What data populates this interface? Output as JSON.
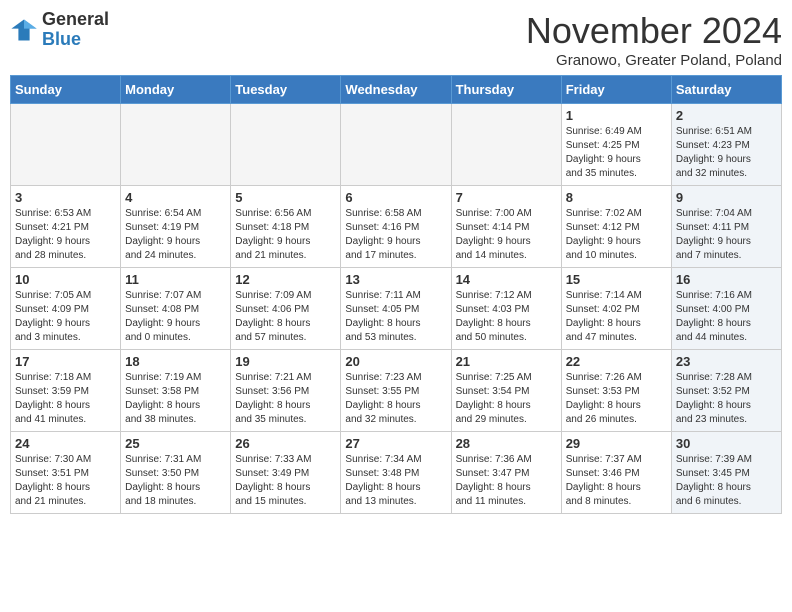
{
  "logo": {
    "general": "General",
    "blue": "Blue"
  },
  "title": "November 2024",
  "location": "Granowo, Greater Poland, Poland",
  "days_of_week": [
    "Sunday",
    "Monday",
    "Tuesday",
    "Wednesday",
    "Thursday",
    "Friday",
    "Saturday"
  ],
  "weeks": [
    [
      {
        "day": "",
        "info": "",
        "empty": true
      },
      {
        "day": "",
        "info": "",
        "empty": true
      },
      {
        "day": "",
        "info": "",
        "empty": true
      },
      {
        "day": "",
        "info": "",
        "empty": true
      },
      {
        "day": "",
        "info": "",
        "empty": true
      },
      {
        "day": "1",
        "info": "Sunrise: 6:49 AM\nSunset: 4:25 PM\nDaylight: 9 hours\nand 35 minutes.",
        "empty": false,
        "shaded": false
      },
      {
        "day": "2",
        "info": "Sunrise: 6:51 AM\nSunset: 4:23 PM\nDaylight: 9 hours\nand 32 minutes.",
        "empty": false,
        "shaded": true
      }
    ],
    [
      {
        "day": "3",
        "info": "Sunrise: 6:53 AM\nSunset: 4:21 PM\nDaylight: 9 hours\nand 28 minutes.",
        "empty": false,
        "shaded": false
      },
      {
        "day": "4",
        "info": "Sunrise: 6:54 AM\nSunset: 4:19 PM\nDaylight: 9 hours\nand 24 minutes.",
        "empty": false,
        "shaded": false
      },
      {
        "day": "5",
        "info": "Sunrise: 6:56 AM\nSunset: 4:18 PM\nDaylight: 9 hours\nand 21 minutes.",
        "empty": false,
        "shaded": false
      },
      {
        "day": "6",
        "info": "Sunrise: 6:58 AM\nSunset: 4:16 PM\nDaylight: 9 hours\nand 17 minutes.",
        "empty": false,
        "shaded": false
      },
      {
        "day": "7",
        "info": "Sunrise: 7:00 AM\nSunset: 4:14 PM\nDaylight: 9 hours\nand 14 minutes.",
        "empty": false,
        "shaded": false
      },
      {
        "day": "8",
        "info": "Sunrise: 7:02 AM\nSunset: 4:12 PM\nDaylight: 9 hours\nand 10 minutes.",
        "empty": false,
        "shaded": false
      },
      {
        "day": "9",
        "info": "Sunrise: 7:04 AM\nSunset: 4:11 PM\nDaylight: 9 hours\nand 7 minutes.",
        "empty": false,
        "shaded": true
      }
    ],
    [
      {
        "day": "10",
        "info": "Sunrise: 7:05 AM\nSunset: 4:09 PM\nDaylight: 9 hours\nand 3 minutes.",
        "empty": false,
        "shaded": false
      },
      {
        "day": "11",
        "info": "Sunrise: 7:07 AM\nSunset: 4:08 PM\nDaylight: 9 hours\nand 0 minutes.",
        "empty": false,
        "shaded": false
      },
      {
        "day": "12",
        "info": "Sunrise: 7:09 AM\nSunset: 4:06 PM\nDaylight: 8 hours\nand 57 minutes.",
        "empty": false,
        "shaded": false
      },
      {
        "day": "13",
        "info": "Sunrise: 7:11 AM\nSunset: 4:05 PM\nDaylight: 8 hours\nand 53 minutes.",
        "empty": false,
        "shaded": false
      },
      {
        "day": "14",
        "info": "Sunrise: 7:12 AM\nSunset: 4:03 PM\nDaylight: 8 hours\nand 50 minutes.",
        "empty": false,
        "shaded": false
      },
      {
        "day": "15",
        "info": "Sunrise: 7:14 AM\nSunset: 4:02 PM\nDaylight: 8 hours\nand 47 minutes.",
        "empty": false,
        "shaded": false
      },
      {
        "day": "16",
        "info": "Sunrise: 7:16 AM\nSunset: 4:00 PM\nDaylight: 8 hours\nand 44 minutes.",
        "empty": false,
        "shaded": true
      }
    ],
    [
      {
        "day": "17",
        "info": "Sunrise: 7:18 AM\nSunset: 3:59 PM\nDaylight: 8 hours\nand 41 minutes.",
        "empty": false,
        "shaded": false
      },
      {
        "day": "18",
        "info": "Sunrise: 7:19 AM\nSunset: 3:58 PM\nDaylight: 8 hours\nand 38 minutes.",
        "empty": false,
        "shaded": false
      },
      {
        "day": "19",
        "info": "Sunrise: 7:21 AM\nSunset: 3:56 PM\nDaylight: 8 hours\nand 35 minutes.",
        "empty": false,
        "shaded": false
      },
      {
        "day": "20",
        "info": "Sunrise: 7:23 AM\nSunset: 3:55 PM\nDaylight: 8 hours\nand 32 minutes.",
        "empty": false,
        "shaded": false
      },
      {
        "day": "21",
        "info": "Sunrise: 7:25 AM\nSunset: 3:54 PM\nDaylight: 8 hours\nand 29 minutes.",
        "empty": false,
        "shaded": false
      },
      {
        "day": "22",
        "info": "Sunrise: 7:26 AM\nSunset: 3:53 PM\nDaylight: 8 hours\nand 26 minutes.",
        "empty": false,
        "shaded": false
      },
      {
        "day": "23",
        "info": "Sunrise: 7:28 AM\nSunset: 3:52 PM\nDaylight: 8 hours\nand 23 minutes.",
        "empty": false,
        "shaded": true
      }
    ],
    [
      {
        "day": "24",
        "info": "Sunrise: 7:30 AM\nSunset: 3:51 PM\nDaylight: 8 hours\nand 21 minutes.",
        "empty": false,
        "shaded": false
      },
      {
        "day": "25",
        "info": "Sunrise: 7:31 AM\nSunset: 3:50 PM\nDaylight: 8 hours\nand 18 minutes.",
        "empty": false,
        "shaded": false
      },
      {
        "day": "26",
        "info": "Sunrise: 7:33 AM\nSunset: 3:49 PM\nDaylight: 8 hours\nand 15 minutes.",
        "empty": false,
        "shaded": false
      },
      {
        "day": "27",
        "info": "Sunrise: 7:34 AM\nSunset: 3:48 PM\nDaylight: 8 hours\nand 13 minutes.",
        "empty": false,
        "shaded": false
      },
      {
        "day": "28",
        "info": "Sunrise: 7:36 AM\nSunset: 3:47 PM\nDaylight: 8 hours\nand 11 minutes.",
        "empty": false,
        "shaded": false
      },
      {
        "day": "29",
        "info": "Sunrise: 7:37 AM\nSunset: 3:46 PM\nDaylight: 8 hours\nand 8 minutes.",
        "empty": false,
        "shaded": false
      },
      {
        "day": "30",
        "info": "Sunrise: 7:39 AM\nSunset: 3:45 PM\nDaylight: 8 hours\nand 6 minutes.",
        "empty": false,
        "shaded": true
      }
    ]
  ]
}
